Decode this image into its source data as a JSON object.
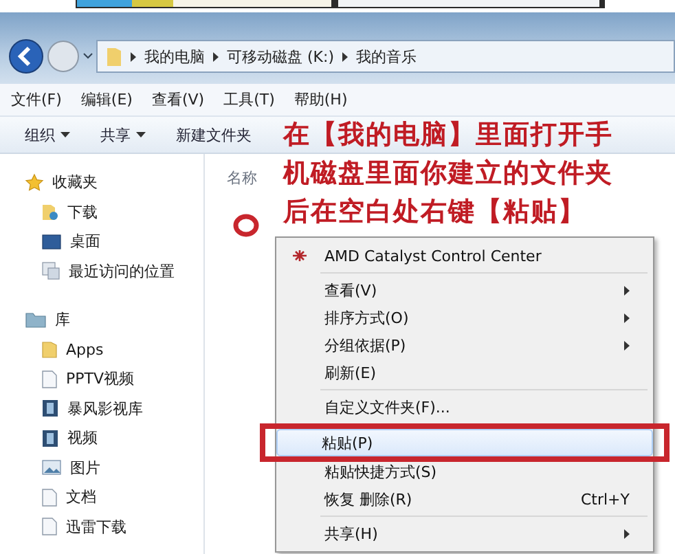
{
  "address_bar": {
    "crumbs": [
      "我的电脑",
      "可移动磁盘 (K:)",
      "我的音乐"
    ]
  },
  "menu_bar": [
    "文件(F)",
    "编辑(E)",
    "查看(V)",
    "工具(T)",
    "帮助(H)"
  ],
  "toolbar": [
    {
      "label": "组织",
      "dropdown": true
    },
    {
      "label": "共享",
      "dropdown": true
    },
    {
      "label": "新建文件夹",
      "dropdown": false
    }
  ],
  "nav_pane": [
    {
      "label": "收藏夹",
      "children": [
        {
          "label": "下载"
        },
        {
          "label": "桌面"
        },
        {
          "label": "最近访问的位置"
        }
      ]
    },
    {
      "label": "库",
      "children": [
        {
          "label": "Apps"
        },
        {
          "label": "PPTV视频"
        },
        {
          "label": "暴风影视库"
        },
        {
          "label": "视频"
        },
        {
          "label": "图片"
        },
        {
          "label": "文档"
        },
        {
          "label": "迅雷下载"
        }
      ]
    }
  ],
  "columns": [
    "名称"
  ],
  "annotation": [
    "在【我的电脑】里面打开手",
    "机磁盘里面你建立的文件夹",
    "后在空白处右键【粘贴】"
  ],
  "context_menu": [
    {
      "kind": "item",
      "label": "AMD Catalyst Control Center",
      "submenu": false,
      "selected": false
    },
    {
      "kind": "separator"
    },
    {
      "kind": "item",
      "label": "查看(V)",
      "submenu": true,
      "selected": false
    },
    {
      "kind": "item",
      "label": "排序方式(O)",
      "submenu": true,
      "selected": false
    },
    {
      "kind": "item",
      "label": "分组依据(P)",
      "submenu": true,
      "selected": false
    },
    {
      "kind": "item",
      "label": "刷新(E)",
      "submenu": false,
      "selected": false
    },
    {
      "kind": "separator"
    },
    {
      "kind": "item",
      "label": "自定义文件夹(F)...",
      "submenu": false,
      "selected": false
    },
    {
      "kind": "separator"
    },
    {
      "kind": "item",
      "label": "粘贴(P)",
      "submenu": false,
      "selected": true
    },
    {
      "kind": "item",
      "label": "粘贴快捷方式(S)",
      "submenu": false,
      "selected": false
    },
    {
      "kind": "item",
      "label": "恢复 删除(R)",
      "shortcut": "Ctrl+Y",
      "submenu": false,
      "selected": false
    },
    {
      "kind": "separator"
    },
    {
      "kind": "item",
      "label": "共享(H)",
      "submenu": true,
      "selected": false
    }
  ]
}
